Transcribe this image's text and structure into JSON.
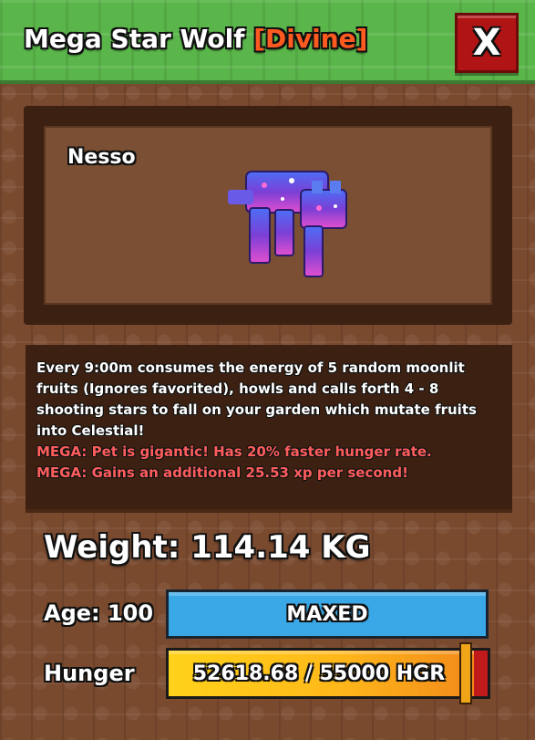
{
  "header": {
    "title": "Mega Star Wolf",
    "rarity": "[Divine]",
    "close_label": "X",
    "rarity_color": "#ff5a1f"
  },
  "pet": {
    "name": "Nesso",
    "icon": "pet-wolf-model"
  },
  "description": {
    "lines": [
      "Every 9:00m consumes the energy of 5 random moonlit",
      "fruits (Ignores favorited), howls and calls forth 4 - 8",
      "shooting stars to fall on your garden which mutate fruits",
      "into Celestial!"
    ],
    "mega_lines": [
      "MEGA: Pet is gigantic! Has 20% faster hunger rate.",
      "MEGA: Gains an additional 25.53 xp per second!"
    ]
  },
  "stats": {
    "weight_text": "Weight: 114.14 KG",
    "age_label": "Age: 100",
    "age_status": "MAXED",
    "hunger_label": "Hunger",
    "hunger_text": "52618.68 / 55000 HGR",
    "hunger_current": 52618.68,
    "hunger_max": 55000
  }
}
